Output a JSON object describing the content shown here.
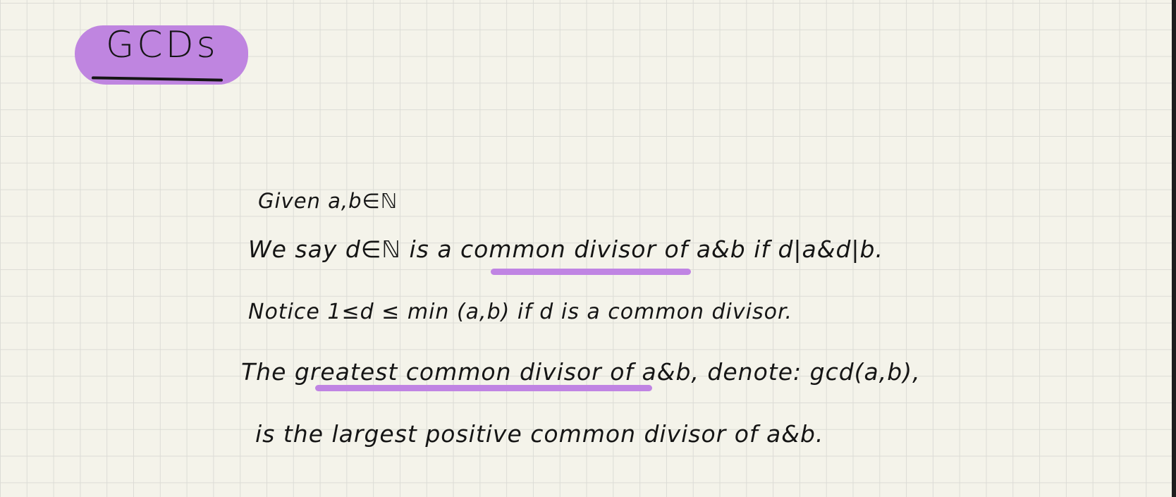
{
  "note": {
    "title": "GCDs",
    "lines": [
      "Given a,b∈ℕ",
      "We say d∈ℕ is a common divisor of a&b if d|a&d|b.",
      "Notice   1≤d ≤ min (a,b) if d is a common divisor.",
      "The greatest common divisor of a&b, denote: gcd(a,b),",
      "is the largest positive common divisor of a&b."
    ],
    "highlight_color": "#c084e3",
    "title_highlight_color": "#bf85e0"
  }
}
